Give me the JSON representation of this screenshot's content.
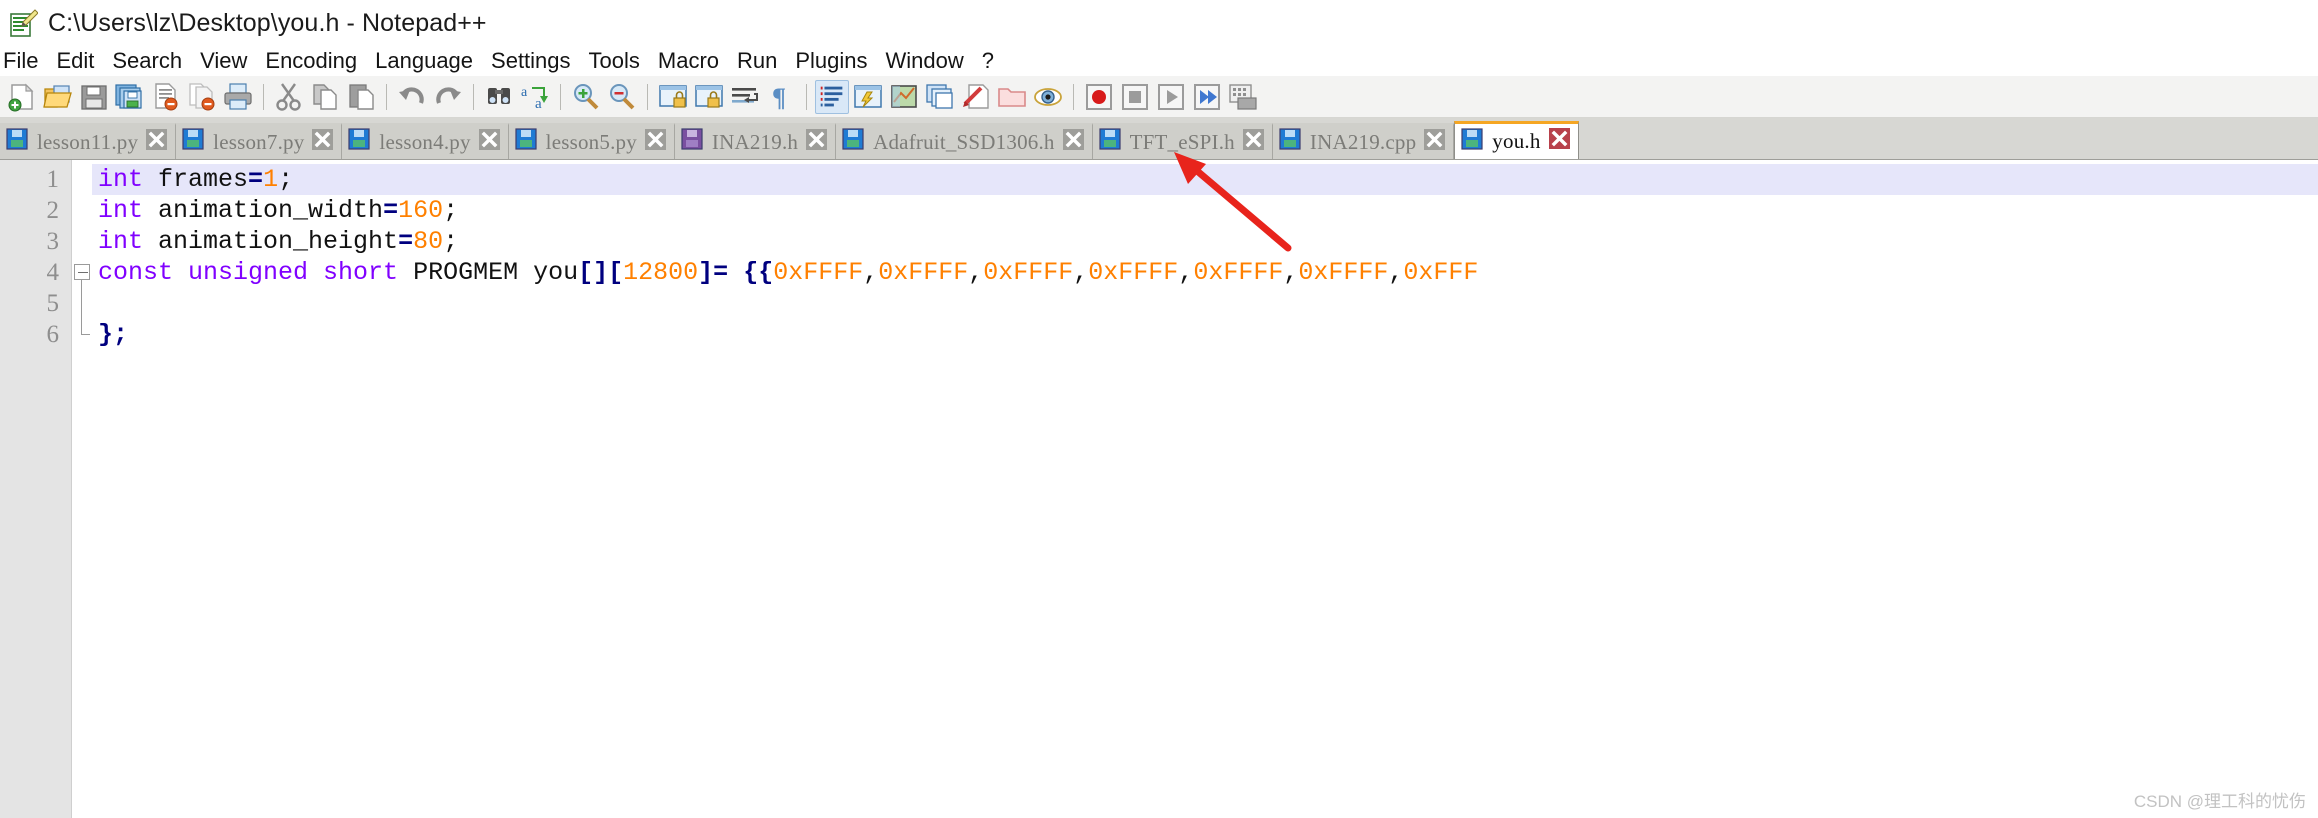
{
  "window": {
    "title": "C:\\Users\\lz\\Desktop\\you.h - Notepad++",
    "app_icon": "notepad-plus-plus-icon"
  },
  "menu": {
    "items": [
      {
        "label": "File"
      },
      {
        "label": "Edit"
      },
      {
        "label": "Search"
      },
      {
        "label": "View"
      },
      {
        "label": "Encoding"
      },
      {
        "label": "Language"
      },
      {
        "label": "Settings"
      },
      {
        "label": "Tools"
      },
      {
        "label": "Macro"
      },
      {
        "label": "Run"
      },
      {
        "label": "Plugins"
      },
      {
        "label": "Window"
      },
      {
        "label": "?"
      }
    ]
  },
  "toolbar": {
    "groups": [
      [
        "new-file-icon",
        "open-file-icon",
        "save-icon",
        "save-all-icon",
        "close-file-icon",
        "close-all-files-icon",
        "print-icon"
      ],
      [
        "cut-icon",
        "copy-icon",
        "paste-icon"
      ],
      [
        "undo-icon",
        "redo-icon"
      ],
      [
        "find-icon",
        "replace-icon"
      ],
      [
        "zoom-in-icon",
        "zoom-out-icon"
      ],
      [
        "sync-vertical-scroll-icon",
        "sync-horizontal-scroll-icon",
        "word-wrap-icon",
        "show-all-characters-icon"
      ],
      [
        "indent-guideline-icon",
        "user-defined-language-icon",
        "document-map-icon",
        "function-list-icon",
        "document-switcher-icon",
        "folder-as-workspace-icon",
        "monitoring-icon"
      ],
      [
        "macro-record-icon",
        "macro-stop-icon",
        "macro-play-icon",
        "macro-playback-multiple-icon",
        "macro-save-icon"
      ]
    ]
  },
  "tabs": {
    "items": [
      {
        "label": "lesson11.py",
        "icon": "save-blue-icon",
        "close_icon": "close-x-icon",
        "active": false
      },
      {
        "label": "lesson7.py",
        "icon": "save-blue-icon",
        "close_icon": "close-x-icon",
        "active": false
      },
      {
        "label": "lesson4.py",
        "icon": "save-blue-icon",
        "close_icon": "close-x-icon",
        "active": false
      },
      {
        "label": "lesson5.py",
        "icon": "save-blue-icon",
        "close_icon": "close-x-icon",
        "active": false
      },
      {
        "label": "INA219.h",
        "icon": "save-purple-icon",
        "close_icon": "close-x-icon",
        "active": false
      },
      {
        "label": "Adafruit_SSD1306.h",
        "icon": "save-blue-icon",
        "close_icon": "close-x-icon",
        "active": false
      },
      {
        "label": "TFT_eSPI.h",
        "icon": "save-blue-icon",
        "close_icon": "close-x-icon",
        "active": false
      },
      {
        "label": "INA219.cpp",
        "icon": "save-blue-icon",
        "close_icon": "close-x-icon",
        "active": false
      },
      {
        "label": "you.h",
        "icon": "save-blue-icon",
        "close_icon": "close-x-red-icon",
        "active": true
      }
    ]
  },
  "editor": {
    "line_numbers": [
      "1",
      "2",
      "3",
      "4",
      "5",
      "6"
    ],
    "current_line": 1,
    "lines": [
      {
        "n": "1",
        "tokens": [
          {
            "t": "int",
            "c": "kw"
          },
          {
            "t": " frames",
            "c": "pl"
          },
          {
            "t": "=",
            "c": "op"
          },
          {
            "t": "1",
            "c": "num"
          },
          {
            "t": ";",
            "c": "pl"
          }
        ]
      },
      {
        "n": "2",
        "tokens": [
          {
            "t": "int",
            "c": "kw"
          },
          {
            "t": " animation_width",
            "c": "pl"
          },
          {
            "t": "=",
            "c": "op"
          },
          {
            "t": "160",
            "c": "num"
          },
          {
            "t": ";",
            "c": "pl"
          }
        ]
      },
      {
        "n": "3",
        "tokens": [
          {
            "t": "int",
            "c": "kw"
          },
          {
            "t": " animation_height",
            "c": "pl"
          },
          {
            "t": "=",
            "c": "op"
          },
          {
            "t": "80",
            "c": "num"
          },
          {
            "t": ";",
            "c": "pl"
          }
        ]
      },
      {
        "n": "4",
        "tokens": [
          {
            "t": "const unsigned short",
            "c": "kw"
          },
          {
            "t": " PROGMEM you",
            "c": "pl"
          },
          {
            "t": "[]",
            "c": "op"
          },
          {
            "t": "[",
            "c": "op"
          },
          {
            "t": "12800",
            "c": "num"
          },
          {
            "t": "]",
            "c": "op"
          },
          {
            "t": "=",
            "c": "op"
          },
          {
            "t": " ",
            "c": "pl"
          },
          {
            "t": "{{",
            "c": "op"
          },
          {
            "t": "0xFFFF",
            "c": "num"
          },
          {
            "t": ",",
            "c": "pl"
          },
          {
            "t": "0xFFFF",
            "c": "num"
          },
          {
            "t": ",",
            "c": "pl"
          },
          {
            "t": "0xFFFF",
            "c": "num"
          },
          {
            "t": ",",
            "c": "pl"
          },
          {
            "t": "0xFFFF",
            "c": "num"
          },
          {
            "t": ",",
            "c": "pl"
          },
          {
            "t": "0xFFFF",
            "c": "num"
          },
          {
            "t": ",",
            "c": "pl"
          },
          {
            "t": "0xFFFF",
            "c": "num"
          },
          {
            "t": ",",
            "c": "pl"
          },
          {
            "t": "0xFFF",
            "c": "num"
          }
        ]
      },
      {
        "n": "5",
        "tokens": []
      },
      {
        "n": "6",
        "tokens": [
          {
            "t": "};",
            "c": "op"
          }
        ]
      }
    ],
    "fold_line": 4
  },
  "annotation": {
    "arrow": "red-arrow-pointing-to-active-tab",
    "color": "#e8241c"
  },
  "watermark": {
    "text": "CSDN @理工科的忧伤"
  },
  "colors": {
    "keyword": "#8000ff",
    "number": "#ff8000",
    "operator": "#00007f",
    "active_tab_top": "#f5a623",
    "current_line_bg": "#e6e6fa",
    "tab_bar_bg": "#d7d7d3"
  }
}
